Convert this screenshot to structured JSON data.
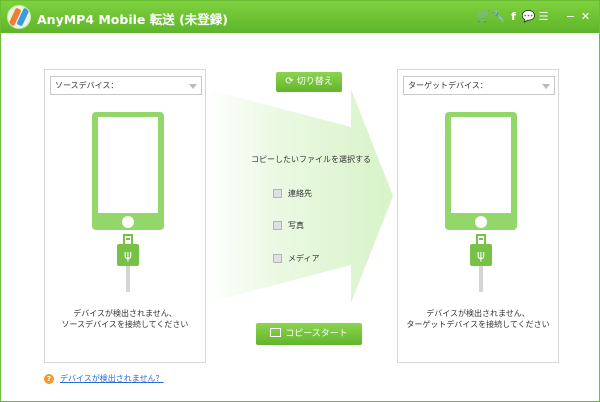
{
  "app": {
    "title": "AnyMP4 Mobile 転送 (未登録)"
  },
  "titlebar": {
    "icons": [
      "cart-icon",
      "key-icon",
      "facebook-icon",
      "chat-icon",
      "menu-icon",
      "minimize-icon",
      "close-icon"
    ],
    "glyphs": {
      "cart": "🛒",
      "key": "🔧",
      "facebook": "f",
      "chat": "💬",
      "menu": "☰",
      "minimize": "−",
      "close": "✕"
    }
  },
  "source": {
    "select_label": "ソースデバイス：",
    "message_line1": "デバイスが検出されません、",
    "message_line2": "ソースデバイスを接続してください"
  },
  "target": {
    "select_label": "ターゲットデバイス：",
    "message_line1": "デバイスが検出されません、",
    "message_line2": "ターゲットデバイスを接続してください"
  },
  "center": {
    "switch_label": "切り替え",
    "prompt": "コピーしたいファイルを選択する",
    "options": [
      {
        "label": "連絡先",
        "checked": false
      },
      {
        "label": "写真",
        "checked": false
      },
      {
        "label": "メディア",
        "checked": false
      }
    ],
    "start_label": "コピースタート"
  },
  "help": {
    "link_text": "デバイスが検出されません？"
  },
  "colors": {
    "accent": "#6cc03a",
    "link": "#2a6ad1",
    "help_icon": "#f39a2b",
    "arrow": "#dcf5d1"
  }
}
